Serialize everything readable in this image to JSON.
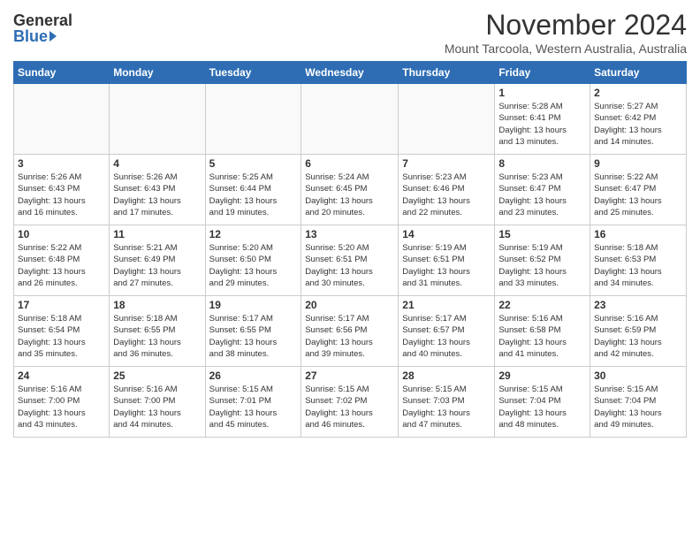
{
  "logo": {
    "general": "General",
    "blue": "Blue"
  },
  "title": "November 2024",
  "subtitle": "Mount Tarcoola, Western Australia, Australia",
  "weekdays": [
    "Sunday",
    "Monday",
    "Tuesday",
    "Wednesday",
    "Thursday",
    "Friday",
    "Saturday"
  ],
  "weeks": [
    [
      {
        "day": "",
        "info": ""
      },
      {
        "day": "",
        "info": ""
      },
      {
        "day": "",
        "info": ""
      },
      {
        "day": "",
        "info": ""
      },
      {
        "day": "",
        "info": ""
      },
      {
        "day": "1",
        "info": "Sunrise: 5:28 AM\nSunset: 6:41 PM\nDaylight: 13 hours\nand 13 minutes."
      },
      {
        "day": "2",
        "info": "Sunrise: 5:27 AM\nSunset: 6:42 PM\nDaylight: 13 hours\nand 14 minutes."
      }
    ],
    [
      {
        "day": "3",
        "info": "Sunrise: 5:26 AM\nSunset: 6:43 PM\nDaylight: 13 hours\nand 16 minutes."
      },
      {
        "day": "4",
        "info": "Sunrise: 5:26 AM\nSunset: 6:43 PM\nDaylight: 13 hours\nand 17 minutes."
      },
      {
        "day": "5",
        "info": "Sunrise: 5:25 AM\nSunset: 6:44 PM\nDaylight: 13 hours\nand 19 minutes."
      },
      {
        "day": "6",
        "info": "Sunrise: 5:24 AM\nSunset: 6:45 PM\nDaylight: 13 hours\nand 20 minutes."
      },
      {
        "day": "7",
        "info": "Sunrise: 5:23 AM\nSunset: 6:46 PM\nDaylight: 13 hours\nand 22 minutes."
      },
      {
        "day": "8",
        "info": "Sunrise: 5:23 AM\nSunset: 6:47 PM\nDaylight: 13 hours\nand 23 minutes."
      },
      {
        "day": "9",
        "info": "Sunrise: 5:22 AM\nSunset: 6:47 PM\nDaylight: 13 hours\nand 25 minutes."
      }
    ],
    [
      {
        "day": "10",
        "info": "Sunrise: 5:22 AM\nSunset: 6:48 PM\nDaylight: 13 hours\nand 26 minutes."
      },
      {
        "day": "11",
        "info": "Sunrise: 5:21 AM\nSunset: 6:49 PM\nDaylight: 13 hours\nand 27 minutes."
      },
      {
        "day": "12",
        "info": "Sunrise: 5:20 AM\nSunset: 6:50 PM\nDaylight: 13 hours\nand 29 minutes."
      },
      {
        "day": "13",
        "info": "Sunrise: 5:20 AM\nSunset: 6:51 PM\nDaylight: 13 hours\nand 30 minutes."
      },
      {
        "day": "14",
        "info": "Sunrise: 5:19 AM\nSunset: 6:51 PM\nDaylight: 13 hours\nand 31 minutes."
      },
      {
        "day": "15",
        "info": "Sunrise: 5:19 AM\nSunset: 6:52 PM\nDaylight: 13 hours\nand 33 minutes."
      },
      {
        "day": "16",
        "info": "Sunrise: 5:18 AM\nSunset: 6:53 PM\nDaylight: 13 hours\nand 34 minutes."
      }
    ],
    [
      {
        "day": "17",
        "info": "Sunrise: 5:18 AM\nSunset: 6:54 PM\nDaylight: 13 hours\nand 35 minutes."
      },
      {
        "day": "18",
        "info": "Sunrise: 5:18 AM\nSunset: 6:55 PM\nDaylight: 13 hours\nand 36 minutes."
      },
      {
        "day": "19",
        "info": "Sunrise: 5:17 AM\nSunset: 6:55 PM\nDaylight: 13 hours\nand 38 minutes."
      },
      {
        "day": "20",
        "info": "Sunrise: 5:17 AM\nSunset: 6:56 PM\nDaylight: 13 hours\nand 39 minutes."
      },
      {
        "day": "21",
        "info": "Sunrise: 5:17 AM\nSunset: 6:57 PM\nDaylight: 13 hours\nand 40 minutes."
      },
      {
        "day": "22",
        "info": "Sunrise: 5:16 AM\nSunset: 6:58 PM\nDaylight: 13 hours\nand 41 minutes."
      },
      {
        "day": "23",
        "info": "Sunrise: 5:16 AM\nSunset: 6:59 PM\nDaylight: 13 hours\nand 42 minutes."
      }
    ],
    [
      {
        "day": "24",
        "info": "Sunrise: 5:16 AM\nSunset: 7:00 PM\nDaylight: 13 hours\nand 43 minutes."
      },
      {
        "day": "25",
        "info": "Sunrise: 5:16 AM\nSunset: 7:00 PM\nDaylight: 13 hours\nand 44 minutes."
      },
      {
        "day": "26",
        "info": "Sunrise: 5:15 AM\nSunset: 7:01 PM\nDaylight: 13 hours\nand 45 minutes."
      },
      {
        "day": "27",
        "info": "Sunrise: 5:15 AM\nSunset: 7:02 PM\nDaylight: 13 hours\nand 46 minutes."
      },
      {
        "day": "28",
        "info": "Sunrise: 5:15 AM\nSunset: 7:03 PM\nDaylight: 13 hours\nand 47 minutes."
      },
      {
        "day": "29",
        "info": "Sunrise: 5:15 AM\nSunset: 7:04 PM\nDaylight: 13 hours\nand 48 minutes."
      },
      {
        "day": "30",
        "info": "Sunrise: 5:15 AM\nSunset: 7:04 PM\nDaylight: 13 hours\nand 49 minutes."
      }
    ]
  ]
}
